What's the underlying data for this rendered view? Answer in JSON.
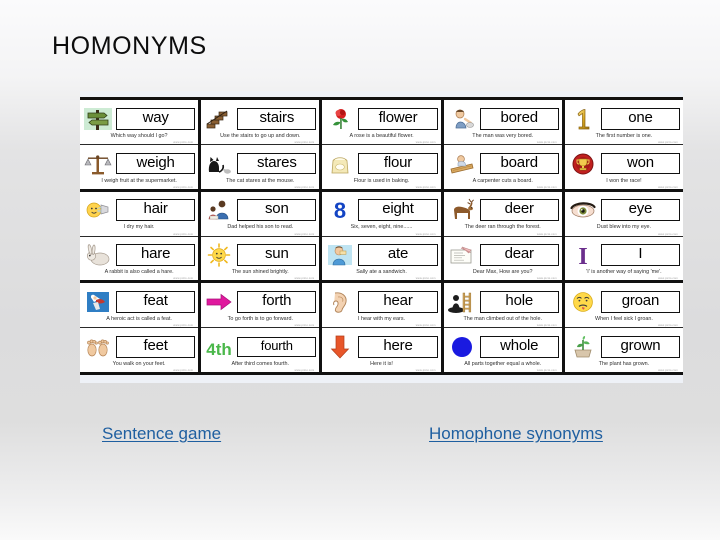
{
  "slide": {
    "title": "HOMONYMS",
    "accent_color": "#1f5fa0",
    "background_color": "#dedede",
    "panel_background": "#eef1f7"
  },
  "cards_table": {
    "columns": 5,
    "blocks": 3,
    "blocks_data": [
      {
        "columns": [
          {
            "cards": [
              {
                "word": "way",
                "caption": "Which way should I go?",
                "icon": "signpost-icon",
                "credit": "www.picto.com"
              },
              {
                "word": "weigh",
                "caption": "I weigh fruit at the supermarket.",
                "icon": "scales-icon",
                "credit": "www.picto.com"
              }
            ]
          },
          {
            "cards": [
              {
                "word": "stairs",
                "caption": "Use the stairs to go up and down.",
                "icon": "stairs-icon",
                "credit": "www.picto.com"
              },
              {
                "word": "stares",
                "caption": "The cat stares at the mouse.",
                "icon": "cat-mouse-icon",
                "credit": "www.picto.com"
              }
            ]
          },
          {
            "cards": [
              {
                "word": "flower",
                "caption": "A rose is a beautiful flower.",
                "icon": "rose-icon",
                "credit": "www.picto.com"
              },
              {
                "word": "flour",
                "caption": "Flour is used in baking.",
                "icon": "flour-bag-icon",
                "credit": "www.picto.com"
              }
            ]
          },
          {
            "cards": [
              {
                "word": "bored",
                "caption": "The man was very bored.",
                "icon": "bored-man-icon",
                "credit": "www.picto.com"
              },
              {
                "word": "board",
                "caption": "A carpenter cuts a board.",
                "icon": "wood-board-icon",
                "credit": "www.picto.com"
              }
            ]
          },
          {
            "cards": [
              {
                "word": "one",
                "caption": "The first number is one.",
                "icon": "number-one-icon",
                "credit": "www.picto.com"
              },
              {
                "word": "won",
                "caption": "I won the race!",
                "icon": "trophy-medal-icon",
                "credit": "www.picto.com"
              }
            ]
          }
        ]
      },
      {
        "columns": [
          {
            "cards": [
              {
                "word": "hair",
                "caption": "I dry my hair.",
                "icon": "hairdryer-icon",
                "credit": "www.picto.com"
              },
              {
                "word": "hare",
                "caption": "A rabbit is also called a hare.",
                "icon": "hare-icon",
                "credit": "www.picto.com"
              }
            ]
          },
          {
            "cards": [
              {
                "word": "son",
                "caption": "Dad helped his son to read.",
                "icon": "father-son-icon",
                "credit": "www.picto.com"
              },
              {
                "word": "sun",
                "caption": "The sun shined brightly.",
                "icon": "sun-icon",
                "credit": "www.picto.com"
              }
            ]
          },
          {
            "cards": [
              {
                "word": "eight",
                "caption": "Six, seven, eight, nine......",
                "icon": "number-eight-icon",
                "credit": "www.picto.com"
              },
              {
                "word": "ate",
                "caption": "Sally ate a sandwich.",
                "icon": "eating-girl-icon",
                "credit": "www.picto.com"
              }
            ]
          },
          {
            "cards": [
              {
                "word": "deer",
                "caption": "The deer ran through the forest.",
                "icon": "deer-icon",
                "credit": "www.picto.com"
              },
              {
                "word": "dear",
                "caption": "Dear Max, How are you?",
                "icon": "letter-icon",
                "credit": "www.picto.com"
              }
            ]
          },
          {
            "cards": [
              {
                "word": "eye",
                "caption": "Dust blew into my eye.",
                "icon": "eye-icon",
                "credit": "www.picto.com"
              },
              {
                "word": "I",
                "caption": "'I' is another way of saying 'me'.",
                "icon": "letter-i-icon",
                "credit": "www.picto.com"
              }
            ]
          }
        ]
      },
      {
        "columns": [
          {
            "cards": [
              {
                "word": "feat",
                "caption": "A heroic act is called a feat.",
                "icon": "superhero-icon",
                "credit": "www.picto.com"
              },
              {
                "word": "feet",
                "caption": "You walk on your feet.",
                "icon": "feet-icon",
                "credit": "www.picto.com"
              }
            ]
          },
          {
            "cards": [
              {
                "word": "forth",
                "caption": "To go forth is to go forward.",
                "icon": "arrow-right-icon",
                "credit": "www.picto.com"
              },
              {
                "word": "fourth",
                "caption": "After third comes fourth.",
                "icon": "fourth-4th-icon",
                "credit": "www.picto.com"
              }
            ]
          },
          {
            "cards": [
              {
                "word": "hear",
                "caption": "I hear with my ears.",
                "icon": "ear-icon",
                "credit": "www.picto.com"
              },
              {
                "word": "here",
                "caption": "Here it is!",
                "icon": "arrow-down-icon",
                "credit": "www.picto.com"
              }
            ]
          },
          {
            "cards": [
              {
                "word": "hole",
                "caption": "The man climbed out of the hole.",
                "icon": "hole-ladder-icon",
                "credit": "www.picto.com"
              },
              {
                "word": "whole",
                "caption": "All parts together equal a whole.",
                "icon": "blue-circle-icon",
                "credit": "www.picto.com"
              }
            ]
          },
          {
            "cards": [
              {
                "word": "groan",
                "caption": "When I feel sick I groan.",
                "icon": "sick-face-icon",
                "credit": "www.picto.com"
              },
              {
                "word": "grown",
                "caption": "The plant has grown.",
                "icon": "plant-icon",
                "credit": "www.picto.com"
              }
            ]
          }
        ]
      }
    ]
  },
  "links": {
    "sentence_game": "Sentence game",
    "homophone_synonyms": "Homophone synonyms"
  }
}
